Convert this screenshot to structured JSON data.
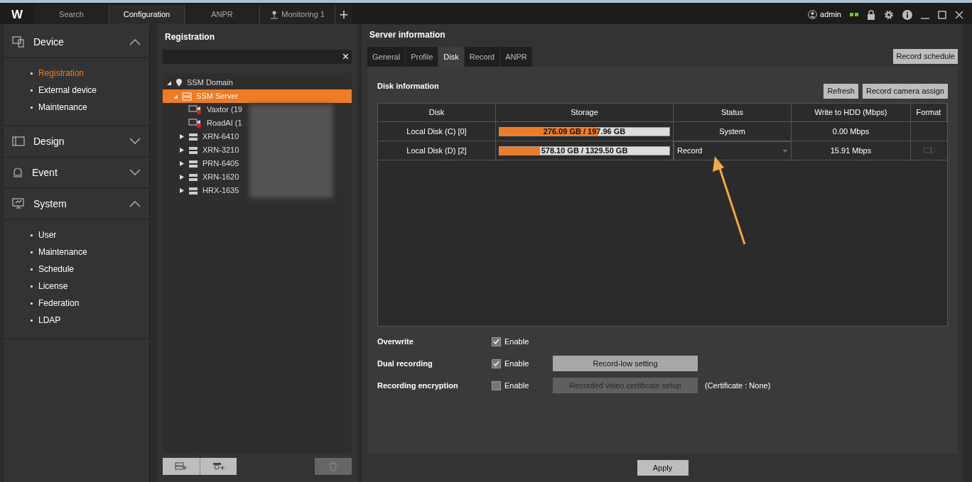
{
  "topbar": {
    "logo": "W",
    "tabs": [
      {
        "label": "Search",
        "selected": false,
        "kind": "text"
      },
      {
        "label": "Configuration",
        "selected": true,
        "kind": "text"
      },
      {
        "label": "ANPR",
        "selected": false,
        "kind": "text"
      },
      {
        "label": "Monitoring 1",
        "selected": false,
        "kind": "monitor"
      }
    ],
    "add": "+",
    "user": "admin"
  },
  "sidebar": [
    {
      "title": "Device",
      "expanded": true,
      "items": [
        {
          "label": "Registration",
          "selected": true
        },
        {
          "label": "External device",
          "selected": false
        },
        {
          "label": "Maintenance",
          "selected": false
        }
      ]
    },
    {
      "title": "Design",
      "expanded": false
    },
    {
      "title": "Event",
      "expanded": false
    },
    {
      "title": "System",
      "expanded": true,
      "items": [
        {
          "label": "User",
          "selected": false
        },
        {
          "label": "Maintenance",
          "selected": false
        },
        {
          "label": "Schedule",
          "selected": false
        },
        {
          "label": "License",
          "selected": false
        },
        {
          "label": "Federation",
          "selected": false
        },
        {
          "label": "LDAP",
          "selected": false
        }
      ]
    }
  ],
  "registration": {
    "title": "Registration",
    "clear": "×",
    "tree": [
      {
        "label": "SSM Domain",
        "kind": "domain",
        "expanded": true,
        "selected": false,
        "children": [
          {
            "label": "SSM Server",
            "kind": "server",
            "expanded": true,
            "selected": true,
            "children": [
              {
                "label": "Vaxtor (19",
                "kind": "camera",
                "selected": false
              },
              {
                "label": "RoadAI (1",
                "kind": "camera",
                "selected": false
              },
              {
                "label": "XRN-6410",
                "kind": "recorder",
                "expanded": false,
                "selected": false
              },
              {
                "label": "XRN-3210",
                "kind": "recorder",
                "expanded": false,
                "selected": false
              },
              {
                "label": "PRN-6405",
                "kind": "recorder",
                "expanded": false,
                "selected": false
              },
              {
                "label": "XRN-1620",
                "kind": "recorder",
                "expanded": false,
                "selected": false
              },
              {
                "label": "HRX-1635",
                "kind": "recorder",
                "expanded": false,
                "selected": false
              }
            ]
          }
        ]
      }
    ]
  },
  "server": {
    "title": "Server information",
    "tabs": [
      {
        "label": "General",
        "selected": false
      },
      {
        "label": "Profile",
        "selected": false
      },
      {
        "label": "Disk",
        "selected": true
      },
      {
        "label": "Record",
        "selected": false
      },
      {
        "label": "ANPR",
        "selected": false
      }
    ],
    "record_schedule": "Record schedule",
    "section": "Disk information",
    "refresh": "Refresh",
    "assign": "Record camera assign",
    "columns": [
      "Disk",
      "Storage",
      "Status",
      "Write to HDD (Mbps)",
      "Format"
    ],
    "rows": [
      {
        "disk": "Local Disk (C) [0]",
        "storage": "276.09 GB / 197.96 GB",
        "level": 0.58,
        "status": "System",
        "status_dropdown": false,
        "write": "0.00 Mbps",
        "format_icon": false
      },
      {
        "disk": "Local Disk (D) [2]",
        "storage": "578.10 GB / 1329.50 GB",
        "level": 0.24,
        "status": "Record",
        "status_dropdown": true,
        "write": "15.91 Mbps",
        "format_icon": true
      }
    ],
    "options": [
      {
        "label": "Overwrite",
        "checked": true,
        "enable": "Enable"
      },
      {
        "label": "Dual recording",
        "checked": true,
        "enable": "Enable",
        "button": "Record-low setting",
        "button_disabled": false
      },
      {
        "label": "Recording encryption",
        "checked": false,
        "enable": "Enable",
        "button": "Recorded video certificate setup",
        "button_disabled": true,
        "note": "(Certificate : None)"
      }
    ],
    "apply": "Apply"
  }
}
